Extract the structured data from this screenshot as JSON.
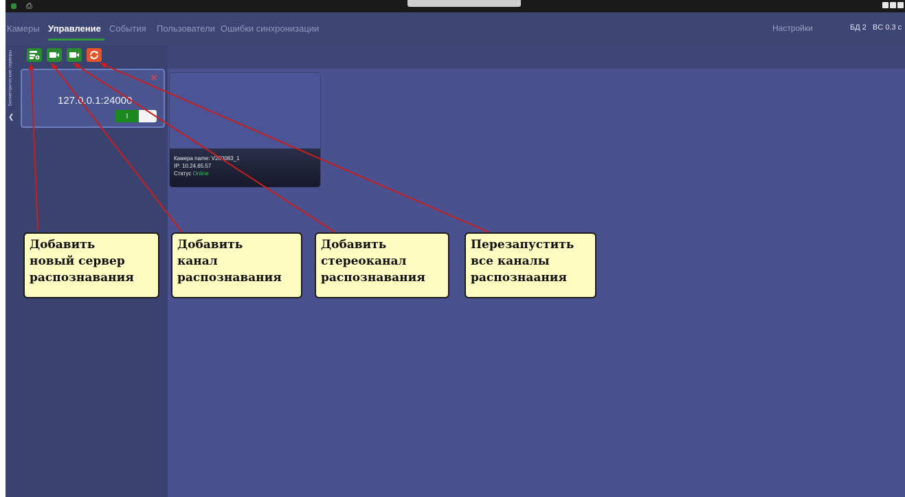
{
  "menu": {
    "items": [
      {
        "label": "Камеры"
      },
      {
        "label": "Управление"
      },
      {
        "label": "События"
      },
      {
        "label": "Пользователи"
      },
      {
        "label": "Ошибки синхронизации"
      }
    ],
    "active_index": 1,
    "settings_label": "Настройки",
    "db_label": "БД 2",
    "bc_label": "BC 0.3 с"
  },
  "sidebar": {
    "vertical_tab_label": "Биометрические серверы",
    "collapse_icon": "chevron-left-icon",
    "toolbar": [
      {
        "name": "add-server-button",
        "icon": "server-add-icon",
        "color": "#2b8a30"
      },
      {
        "name": "add-channel-button",
        "icon": "video-camera-icon",
        "color": "#2b8a30"
      },
      {
        "name": "add-stereo-channel-button",
        "icon": "video-camera-icon",
        "color": "#2b8a30"
      },
      {
        "name": "restart-channels-button",
        "icon": "refresh-icon",
        "color": "#e5532a"
      }
    ],
    "server": {
      "address": "127.0.0.1:24000",
      "close_icon": "close-icon",
      "toggle_on_label": "I",
      "enabled": true
    }
  },
  "camera": {
    "name_line": "Камера name: V260083_1",
    "ip_line": "IP: 10.24.65.57",
    "status_label": "Статус",
    "status_value": "Online",
    "status_color": "#34c34a"
  },
  "callouts": [
    {
      "text": "Добавить\nновый сервер\nраспознавания"
    },
    {
      "text": "Добавить\nканал\nраспознавания"
    },
    {
      "text": "Добавить\nстереоканал\nраспознавания"
    },
    {
      "text": "Перезапустить\nвсе каналы\nраспознаания"
    }
  ],
  "colors": {
    "background": "#49528e",
    "accent_green": "#2b8a30",
    "accent_orange": "#e5532a",
    "arrow": "#c81e1e"
  }
}
